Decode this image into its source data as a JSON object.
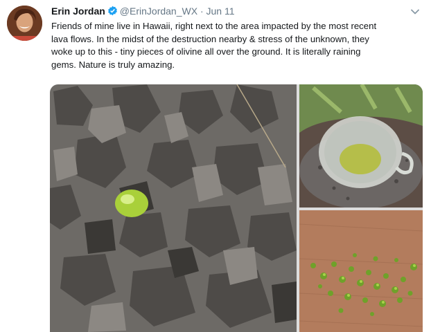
{
  "tweet": {
    "author_name": "Erin Jordan",
    "handle": "@ErinJordan_WX",
    "separator": "·",
    "date": "Jun 11",
    "text_lines": [
      "Friends of mine live in Hawaii, right next to the area impacted by the most recent",
      "lava flows. In the midst of the destruction nearby & stress of the unknown, they",
      "woke up to this - tiny pieces of olivine all over the ground. It is literally raining",
      "gems. Nature is truly amazing."
    ]
  },
  "icons": {
    "verified": "verified-badge-icon",
    "menu": "chevron-down-icon"
  },
  "colors": {
    "verified_blue": "#1da1f2",
    "secondary_text": "#657786",
    "olivine_green": "#9ec43a"
  }
}
